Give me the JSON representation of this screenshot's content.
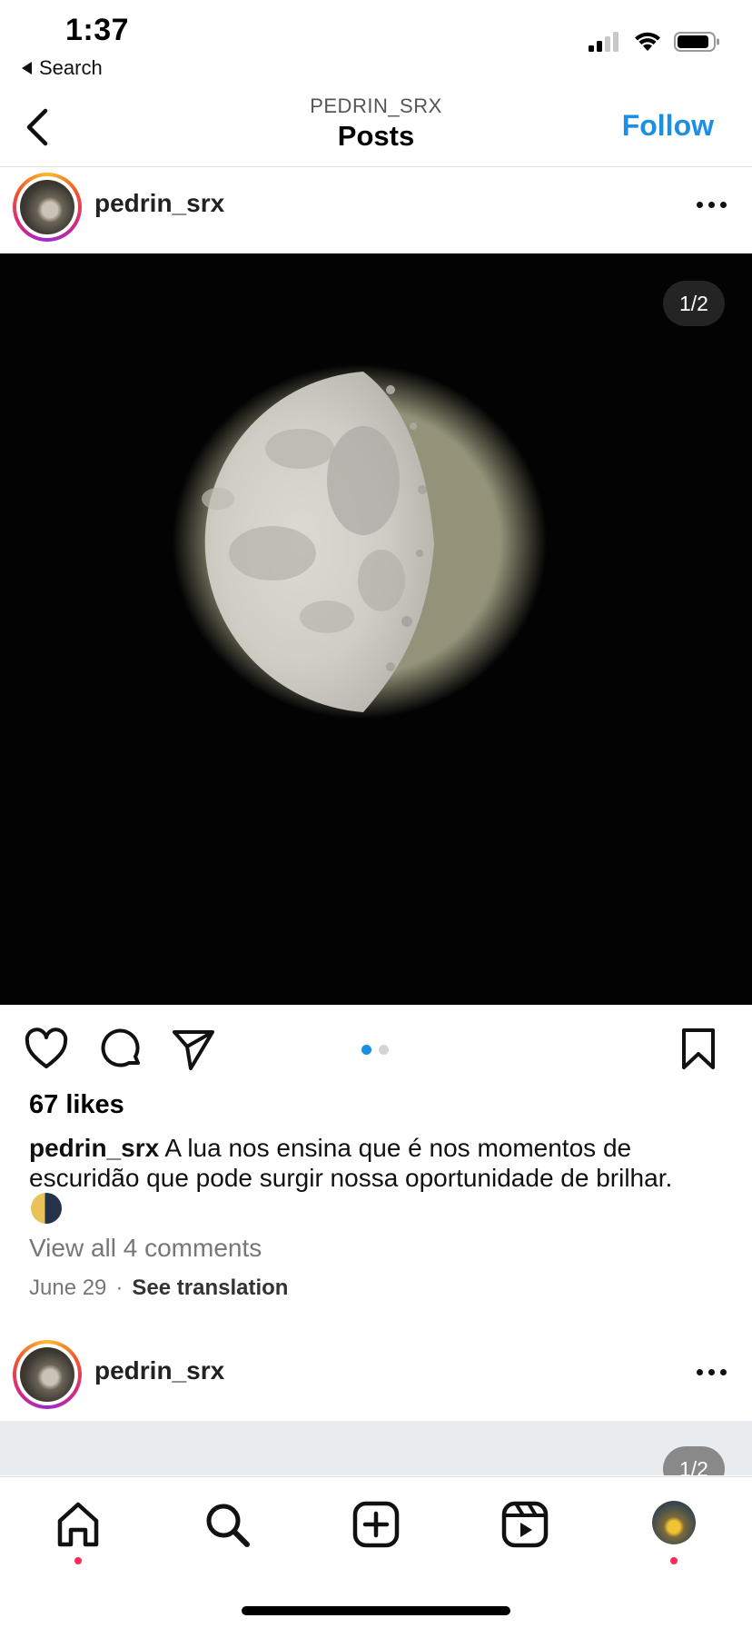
{
  "status_bar": {
    "time": "1:37",
    "back_label": "Search"
  },
  "header": {
    "subtitle": "PEDRIN_SRX",
    "title": "Posts",
    "follow_label": "Follow"
  },
  "post": {
    "username": "pedrin_srx",
    "image_counter": "1/2",
    "carousel": {
      "count": 2,
      "active_index": 0
    },
    "likes": "67 likes",
    "caption_user": "pedrin_srx",
    "caption_text": "A lua nos ensina que é nos momentos de escuridão que pode surgir nossa oportunidade de brilhar.",
    "view_comments": "View all 4 comments",
    "date": "June 29",
    "separator": "·",
    "see_translation": "See translation"
  },
  "next_post": {
    "username": "pedrin_srx",
    "image_counter": "1/2"
  },
  "icons": {
    "back": "chevron-left-icon",
    "more": "more-horizontal-icon",
    "like": "heart-icon",
    "comment": "comment-icon",
    "share": "send-icon",
    "save": "bookmark-icon",
    "tabs": [
      "home-icon",
      "search-icon",
      "create-icon",
      "reels-icon",
      "profile-avatar"
    ]
  },
  "colors": {
    "accent": "#1a8fe3",
    "notification_dot": "#ff2d55"
  }
}
